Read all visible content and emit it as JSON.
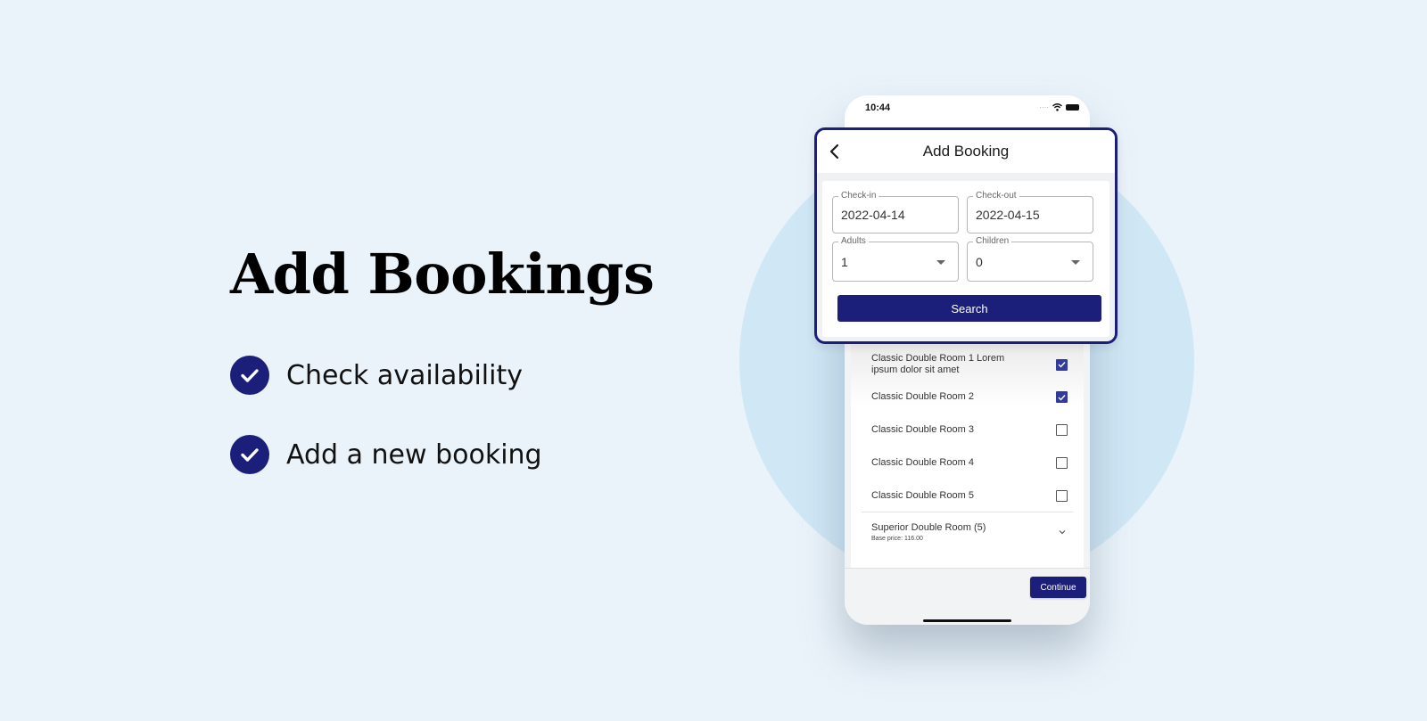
{
  "promo": {
    "title": "Add Bookings",
    "features": [
      {
        "icon": "check-circle-icon",
        "label": "Check availability"
      },
      {
        "icon": "check-circle-icon",
        "label": "Add a new booking"
      }
    ],
    "accent_color": "#1b1f7a"
  },
  "phone": {
    "status_bar": {
      "time": "10:44",
      "icons": [
        "signal-icon",
        "wifi-icon",
        "battery-icon"
      ]
    },
    "header": {
      "back_icon": "chevron-left-icon",
      "title": "Add Booking"
    },
    "form": {
      "check_in": {
        "label": "Check-in",
        "value": "2022-04-14"
      },
      "check_out": {
        "label": "Check-out",
        "value": "2022-04-15"
      },
      "adults": {
        "label": "Adults",
        "value": "1"
      },
      "children": {
        "label": "Children",
        "value": "0"
      },
      "search_label": "Search"
    },
    "rooms": [
      {
        "name": "Classic Double Room 1 Lorem ipsum dolor sit amet",
        "checked": true
      },
      {
        "name": "Classic Double Room 2",
        "checked": true
      },
      {
        "name": "Classic Double Room 3",
        "checked": false
      },
      {
        "name": "Classic Double Room 4",
        "checked": false
      },
      {
        "name": "Classic Double Room 5",
        "checked": false
      }
    ],
    "room_group": {
      "name": "Superior Double Room (5)",
      "subtitle": "Base price: 116.00",
      "icon": "chevron-down-icon"
    },
    "continue_label": "Continue"
  }
}
